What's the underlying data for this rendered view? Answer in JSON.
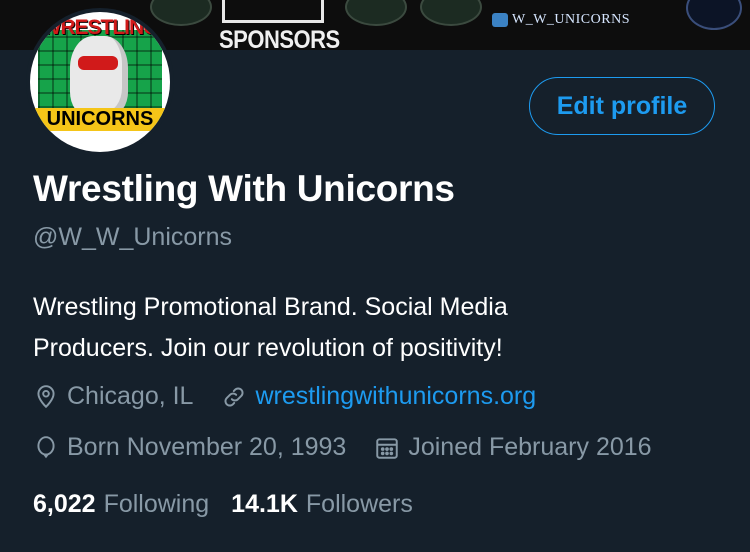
{
  "banner": {
    "sponsors_label": "SPONSORS",
    "social_handle": "W_W_UNICORNS"
  },
  "avatar": {
    "top_word": "WRESTLING",
    "bottom_word": "UNICORNS"
  },
  "edit_profile_label": "Edit profile",
  "profile": {
    "display_name": "Wrestling With Unicorns",
    "handle": "@W_W_Unicorns",
    "bio_line1": "Wrestling Promotional Brand. Social Media",
    "bio_line2": "Producers. Join our revolution of positivity!",
    "location": "Chicago, IL",
    "website": "wrestlingwithunicorns.org",
    "birthday": "Born November 20, 1993",
    "joined": "Joined February 2016"
  },
  "stats": {
    "following_count": "6,022",
    "following_label": "Following",
    "followers_count": "14.1K",
    "followers_label": "Followers"
  },
  "icons": {
    "location": "location-pin-icon",
    "link": "link-icon",
    "birthday": "balloon-icon",
    "calendar": "calendar-icon"
  },
  "colors": {
    "background": "#15202b",
    "accent": "#1d9bf0",
    "secondary_text": "#8899a6",
    "primary_text": "#ffffff"
  }
}
